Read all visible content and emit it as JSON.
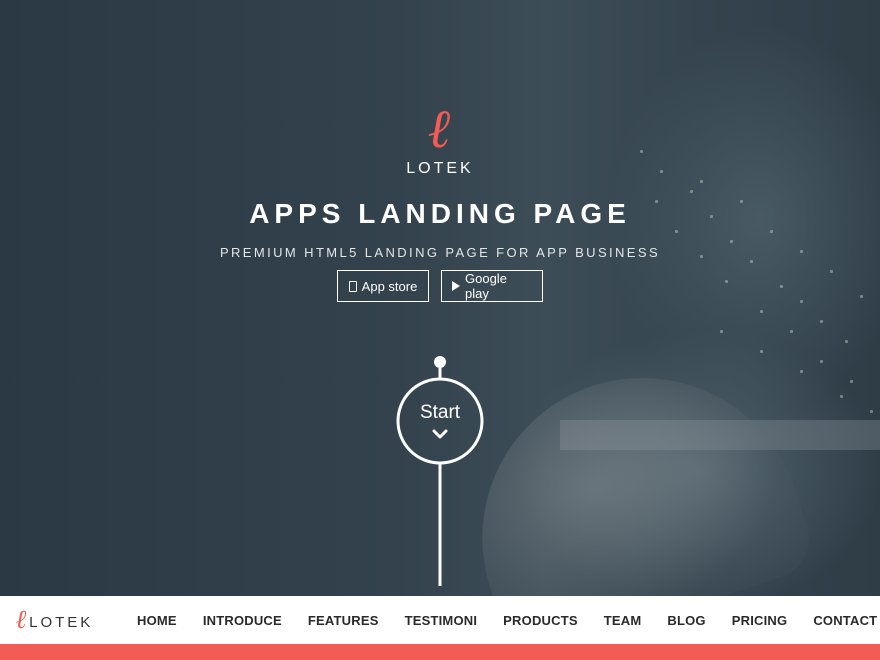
{
  "hero": {
    "logo_mark": "ℓ",
    "logo_text": "LOTEK",
    "title": "APPS LANDING PAGE",
    "subtitle": "PREMIUM HTML5 LANDING PAGE FOR APP BUSINESS",
    "buttons": [
      {
        "label": "App store",
        "icon": "tablet-icon"
      },
      {
        "label": "Google play",
        "icon": "play-icon"
      }
    ],
    "start_label": "Start",
    "start_icon": "chevron-down-icon"
  },
  "nav": {
    "logo_mark": "ℓ",
    "logo_text": "LOTEK",
    "items": [
      "HOME",
      "INTRODUCE",
      "FEATURES",
      "TESTIMONI",
      "PRODUCTS",
      "TEAM",
      "BLOG",
      "PRICING",
      "CONTACT"
    ]
  },
  "colors": {
    "accent": "#f25c54",
    "hero_overlay": "#2d3b46",
    "nav_bg": "#ffffff",
    "nav_text": "#2a2a2a"
  }
}
